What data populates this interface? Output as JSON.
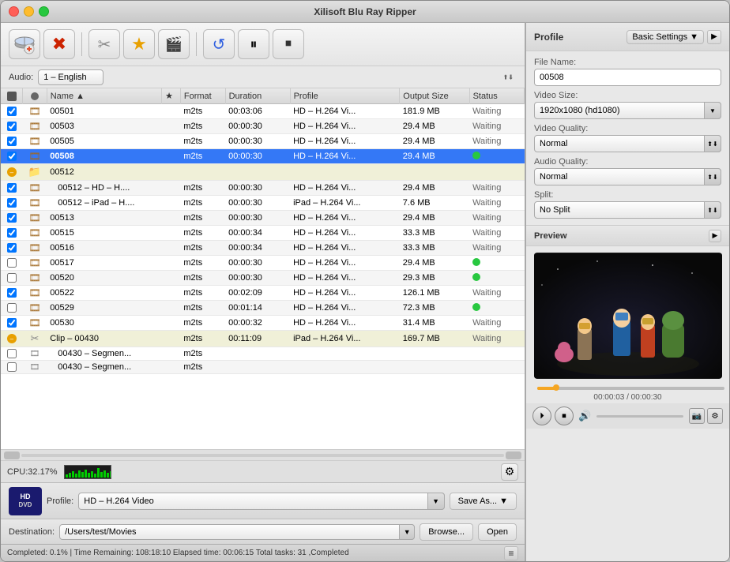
{
  "window": {
    "title": "Xilisoft Blu Ray Ripper"
  },
  "toolbar": {
    "buttons": [
      {
        "name": "add-file-btn",
        "icon": "💿",
        "label": "Add File"
      },
      {
        "name": "remove-btn",
        "icon": "✖",
        "label": "Remove"
      },
      {
        "name": "cut-btn",
        "icon": "✂",
        "label": "Cut"
      },
      {
        "name": "star-btn",
        "icon": "★",
        "label": "Favorite"
      },
      {
        "name": "effects-btn",
        "icon": "🎬",
        "label": "Effects"
      },
      {
        "name": "convert-btn",
        "icon": "↺",
        "label": "Convert"
      },
      {
        "name": "pause-btn",
        "icon": "⏸",
        "label": "Pause"
      },
      {
        "name": "stop-btn",
        "icon": "⏹",
        "label": "Stop"
      }
    ]
  },
  "audio_bar": {
    "label": "Audio:",
    "value": "1 – English"
  },
  "table": {
    "headers": [
      "",
      "",
      "Name",
      "★",
      "Format",
      "Duration",
      "Profile",
      "Output Size",
      "Status"
    ],
    "rows": [
      {
        "check": true,
        "icon": "film",
        "name": "00501",
        "star": false,
        "format": "m2ts",
        "duration": "00:03:06",
        "profile": "HD – H.264 Vi...",
        "size": "181.9 MB",
        "status": "Waiting",
        "selected": false,
        "group": false
      },
      {
        "check": true,
        "icon": "film",
        "name": "00503",
        "star": false,
        "format": "m2ts",
        "duration": "00:00:30",
        "profile": "HD – H.264 Vi...",
        "size": "29.4 MB",
        "status": "Waiting",
        "selected": false,
        "group": false
      },
      {
        "check": true,
        "icon": "film",
        "name": "00505",
        "star": false,
        "format": "m2ts",
        "duration": "00:00:30",
        "profile": "HD – H.264 Vi...",
        "size": "29.4 MB",
        "status": "Waiting",
        "selected": false,
        "group": false
      },
      {
        "check": true,
        "icon": "film",
        "name": "00508",
        "star": false,
        "format": "m2ts",
        "duration": "00:00:30",
        "profile": "HD – H.264 Vi...",
        "size": "29.4 MB",
        "status": "",
        "statusGreen": true,
        "selected": true,
        "group": false
      },
      {
        "check": false,
        "icon": "folder",
        "name": "00512",
        "star": false,
        "format": "",
        "duration": "",
        "profile": "",
        "size": "",
        "status": "",
        "statusGreen": false,
        "selected": false,
        "group": true
      },
      {
        "check": true,
        "icon": "film",
        "name": "00512 – HD – H....",
        "star": false,
        "format": "m2ts",
        "duration": "00:00:30",
        "profile": "HD – H.264 Vi...",
        "size": "29.4 MB",
        "status": "Waiting",
        "selected": false,
        "group": false,
        "indent": true
      },
      {
        "check": true,
        "icon": "film",
        "name": "00512 – iPad – H....",
        "star": false,
        "format": "m2ts",
        "duration": "00:00:30",
        "profile": "iPad – H.264 Vi...",
        "size": "7.6 MB",
        "status": "Waiting",
        "selected": false,
        "group": false,
        "indent": true
      },
      {
        "check": true,
        "icon": "film",
        "name": "00513",
        "star": false,
        "format": "m2ts",
        "duration": "00:00:30",
        "profile": "HD – H.264 Vi...",
        "size": "29.4 MB",
        "status": "Waiting",
        "selected": false,
        "group": false
      },
      {
        "check": true,
        "icon": "film",
        "name": "00515",
        "star": false,
        "format": "m2ts",
        "duration": "00:00:34",
        "profile": "HD – H.264 Vi...",
        "size": "33.3 MB",
        "status": "Waiting",
        "selected": false,
        "group": false
      },
      {
        "check": true,
        "icon": "film",
        "name": "00516",
        "star": false,
        "format": "m2ts",
        "duration": "00:00:34",
        "profile": "HD – H.264 Vi...",
        "size": "33.3 MB",
        "status": "Waiting",
        "selected": false,
        "group": false
      },
      {
        "check": false,
        "icon": "film",
        "name": "00517",
        "star": false,
        "format": "m2ts",
        "duration": "00:00:30",
        "profile": "HD – H.264 Vi...",
        "size": "29.4 MB",
        "status": "",
        "statusGreen": true,
        "selected": false,
        "group": false
      },
      {
        "check": false,
        "icon": "film",
        "name": "00520",
        "star": false,
        "format": "m2ts",
        "duration": "00:00:30",
        "profile": "HD – H.264 Vi...",
        "size": "29.3 MB",
        "status": "",
        "statusGreen": true,
        "selected": false,
        "group": false
      },
      {
        "check": true,
        "icon": "film",
        "name": "00522",
        "star": false,
        "format": "m2ts",
        "duration": "00:02:09",
        "profile": "HD – H.264 Vi...",
        "size": "126.1 MB",
        "status": "Waiting",
        "selected": false,
        "group": false
      },
      {
        "check": false,
        "icon": "film",
        "name": "00529",
        "star": false,
        "format": "m2ts",
        "duration": "00:01:14",
        "profile": "HD – H.264 Vi...",
        "size": "72.3 MB",
        "status": "",
        "statusGreen": true,
        "selected": false,
        "group": false
      },
      {
        "check": true,
        "icon": "film",
        "name": "00530",
        "star": false,
        "format": "m2ts",
        "duration": "00:00:32",
        "profile": "HD – H.264 Vi...",
        "size": "31.4 MB",
        "status": "Waiting",
        "selected": false,
        "group": false
      },
      {
        "check": false,
        "icon": "scissors",
        "name": "Clip – 00430",
        "star": false,
        "format": "m2ts",
        "duration": "00:11:09",
        "profile": "iPad – H.264 Vi...",
        "size": "169.7 MB",
        "status": "Waiting",
        "selected": false,
        "group": true
      },
      {
        "check": false,
        "icon": "film-small",
        "name": "00430 – Segmen...",
        "star": false,
        "format": "m2ts",
        "duration": "",
        "profile": "",
        "size": "",
        "status": "",
        "statusGreen": false,
        "selected": false,
        "group": false,
        "indent": true
      },
      {
        "check": false,
        "icon": "film-small",
        "name": "00430 – Segmen...",
        "star": false,
        "format": "m2ts",
        "duration": "",
        "profile": "",
        "size": "",
        "status": "",
        "statusGreen": false,
        "selected": false,
        "group": false,
        "indent": true
      }
    ]
  },
  "cpu": {
    "label": "CPU:32.17%",
    "bars": [
      4,
      6,
      8,
      5,
      9,
      7,
      10,
      6,
      8,
      5,
      12,
      7,
      9,
      6,
      8
    ]
  },
  "profile_bar": {
    "label": "Profile:",
    "value": "HD – H.264 Video",
    "save_as": "Save As...",
    "hd_line1": "HD",
    "hd_line2": "DVD"
  },
  "destination_bar": {
    "label": "Destination:",
    "value": "/Users/test/Movies",
    "browse": "Browse...",
    "open": "Open"
  },
  "status_bar": {
    "text": "Completed: 0.1%  |  Time Remaining: 108:18:10  Elapsed time: 00:06:15  Total tasks: 31 ,Completed"
  },
  "right_panel": {
    "profile_label": "Profile",
    "basic_settings": "Basic Settings",
    "form": {
      "file_name_label": "File Name:",
      "file_name_value": "00508",
      "video_size_label": "Video Size:",
      "video_size_value": "1920x1080 (hd1080)",
      "video_quality_label": "Video Quality:",
      "video_quality_value": "Normal",
      "audio_quality_label": "Audio Quality:",
      "audio_quality_value": "Normal",
      "split_label": "Split:",
      "split_value": "No Split"
    },
    "preview": {
      "label": "Preview",
      "time_current": "00:00:03",
      "time_total": "00:00:30",
      "time_display": "00:00:03 / 00:00:30",
      "progress_pct": 10
    }
  }
}
